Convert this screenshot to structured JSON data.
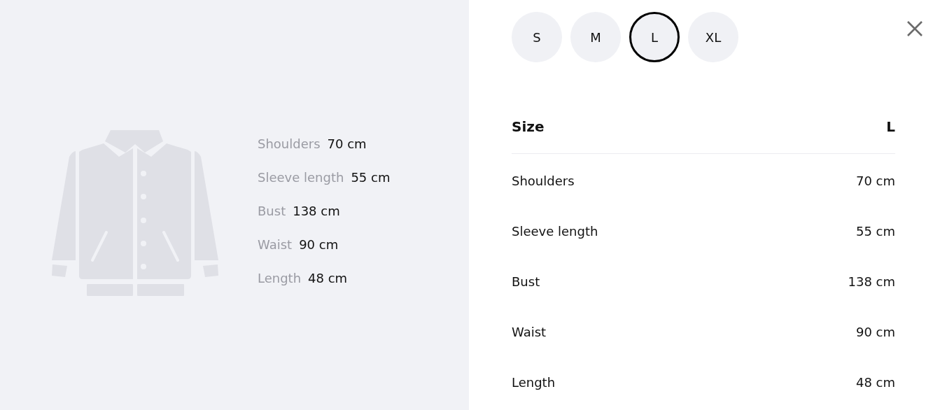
{
  "preview": {
    "measurements": [
      {
        "label": "Shoulders",
        "value": "70 cm"
      },
      {
        "label": "Sleeve length",
        "value": "55 cm"
      },
      {
        "label": "Bust",
        "value": "138 cm"
      },
      {
        "label": "Waist",
        "value": "90 cm"
      },
      {
        "label": "Length",
        "value": "48 cm"
      }
    ]
  },
  "sizes": [
    {
      "label": "S",
      "selected": false
    },
    {
      "label": "M",
      "selected": false
    },
    {
      "label": "L",
      "selected": true
    },
    {
      "label": "XL",
      "selected": false
    }
  ],
  "table": {
    "header": {
      "label": "Size",
      "value": "L"
    },
    "rows": [
      {
        "label": "Shoulders",
        "value": "70 cm"
      },
      {
        "label": "Sleeve length",
        "value": "55 cm"
      },
      {
        "label": "Bust",
        "value": "138 cm"
      },
      {
        "label": "Waist",
        "value": "90 cm"
      },
      {
        "label": "Length",
        "value": "48 cm"
      }
    ]
  }
}
